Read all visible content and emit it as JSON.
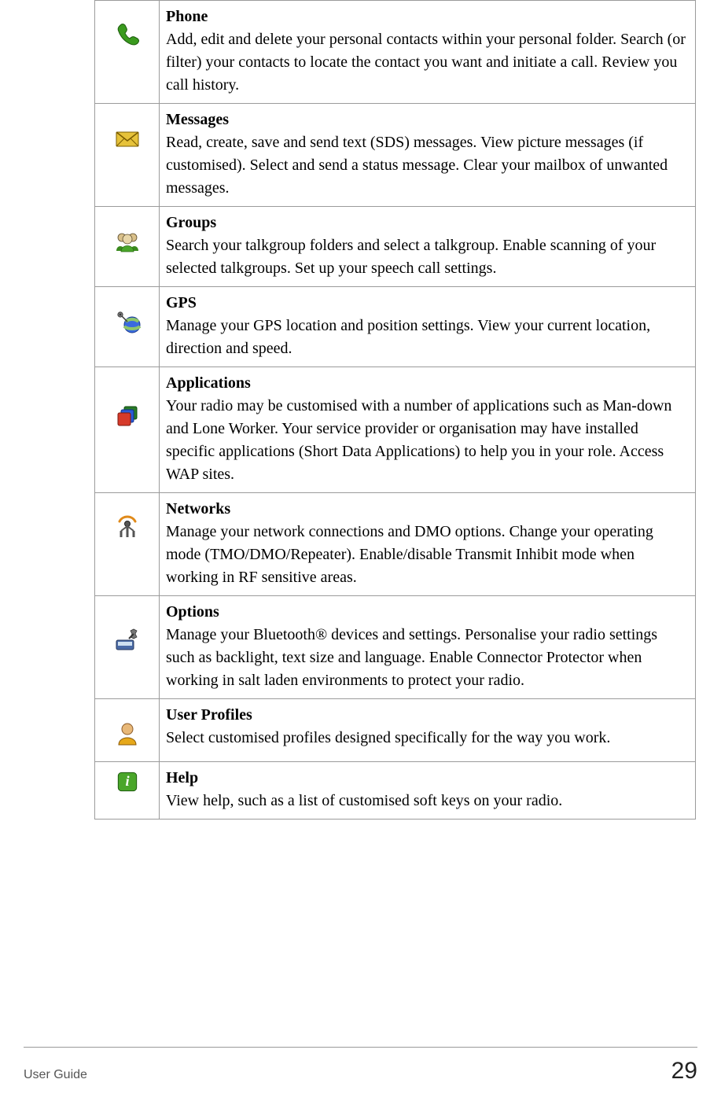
{
  "rows": [
    {
      "icon": "phone-icon",
      "title": "Phone",
      "desc": "Add, edit and delete your personal contacts within your personal folder. Search (or filter) your contacts to locate the contact you want and initiate a call. Review you call history."
    },
    {
      "icon": "messages-icon",
      "title": "Messages",
      "desc": "Read, create, save and send text (SDS) messages. View picture messages (if customised). Select and send a status message. Clear your mailbox of unwanted messages."
    },
    {
      "icon": "groups-icon",
      "title": "Groups",
      "desc": "Search your talkgroup folders and select a talkgroup. Enable scanning of your selected talkgroups. Set up your speech call settings."
    },
    {
      "icon": "gps-icon",
      "title": "GPS",
      "desc": "Manage your GPS location and position settings. View your current location, direction and speed."
    },
    {
      "icon": "applications-icon",
      "title": "Applications",
      "desc": "Your radio may be customised with a number of applications such as Man-down and Lone Worker. Your service provider or organisation may have installed specific applications (Short Data Applications) to help you in your role. Access WAP sites."
    },
    {
      "icon": "networks-icon",
      "title": "Networks",
      "desc": "Manage your network connections and DMO options. Change your operating mode (TMO/DMO/Repeater). Enable/disable Transmit Inhibit mode when working in RF sensitive areas."
    },
    {
      "icon": "options-icon",
      "title": "Options",
      "desc": "Manage your Bluetooth® devices and settings. Personalise your radio settings such as backlight, text size and language. Enable Connector Protector when working in salt laden environments to protect your radio."
    },
    {
      "icon": "user-profiles-icon",
      "title": "User Profiles",
      "desc": "Select customised profiles designed specifically for the way you work."
    },
    {
      "icon": "help-icon",
      "title": "Help",
      "desc": "View help, such as a list of customised soft keys on your radio."
    }
  ],
  "footer": {
    "doc_title": "User Guide",
    "page_number": "29"
  }
}
